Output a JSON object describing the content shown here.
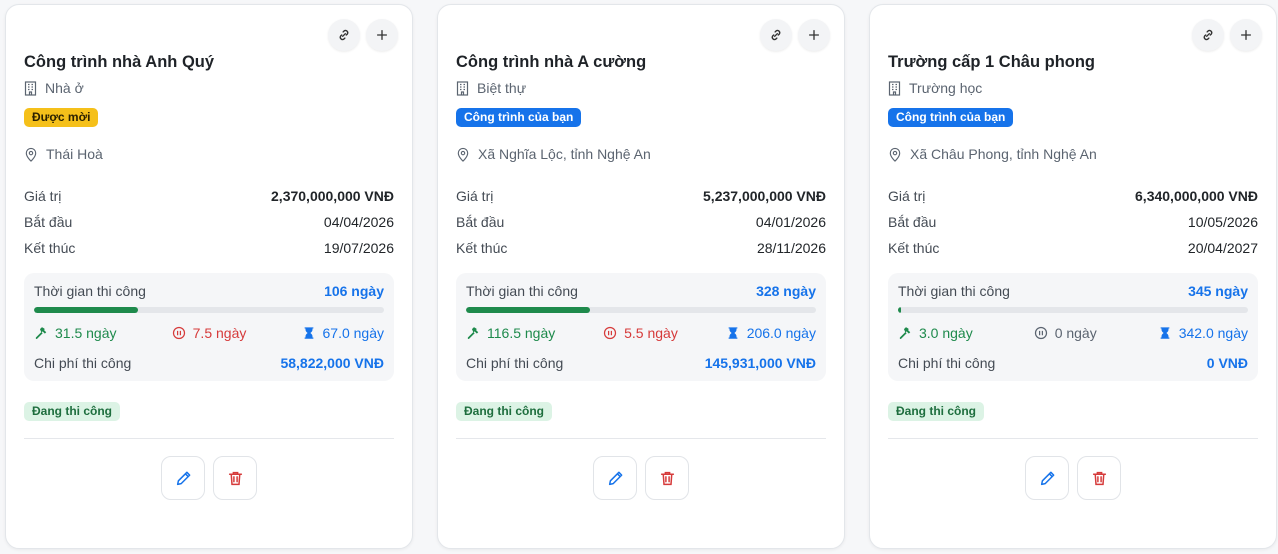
{
  "colors": {
    "accent": "#1673ea",
    "success": "#1e8a4c",
    "danger": "#d63a3a",
    "invited": "#f5c01a"
  },
  "labels": {
    "value": "Giá trị",
    "start": "Bắt đầu",
    "end": "Kết thúc",
    "duration": "Thời gian thi công",
    "cost": "Chi phí thi công"
  },
  "projects": [
    {
      "title": "Công trình nhà Anh Quý",
      "type": "Nhà ở",
      "badge": "Được mời",
      "badge_style": "yellow",
      "location": "Thái Hoà",
      "value": "2,370,000,000 VNĐ",
      "start": "04/04/2026",
      "end": "19/07/2026",
      "duration": "106 ngày",
      "progress_fraction": 0.297,
      "worked": "31.5 ngày",
      "paused": "7.5 ngày",
      "paused_color": "red",
      "remaining": "67.0 ngày",
      "cost": "58,822,000 VNĐ",
      "status": "Đang thi công"
    },
    {
      "title": "Công trình nhà A cường",
      "type": "Biệt thự",
      "badge": "Công trình của bạn",
      "badge_style": "blue",
      "location": "Xã Nghĩa Lộc, tỉnh Nghệ An",
      "value": "5,237,000,000 VNĐ",
      "start": "04/01/2026",
      "end": "28/11/2026",
      "duration": "328 ngày",
      "progress_fraction": 0.355,
      "worked": "116.5 ngày",
      "paused": "5.5 ngày",
      "paused_color": "red",
      "remaining": "206.0 ngày",
      "cost": "145,931,000 VNĐ",
      "status": "Đang thi công"
    },
    {
      "title": "Trường cấp 1 Châu phong",
      "type": "Trường học",
      "badge": "Công trình của bạn",
      "badge_style": "blue",
      "location": "Xã Châu Phong, tỉnh Nghệ An",
      "value": "6,340,000,000 VNĐ",
      "start": "10/05/2026",
      "end": "20/04/2027",
      "duration": "345 ngày",
      "progress_fraction": 0.009,
      "worked": "3.0 ngày",
      "paused": "0 ngày",
      "paused_color": "grey",
      "remaining": "342.0 ngày",
      "cost": "0 VNĐ",
      "status": "Đang thi công"
    }
  ]
}
